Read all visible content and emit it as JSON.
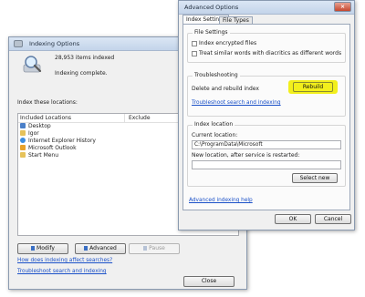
{
  "indexing_window": {
    "title": "Indexing Options",
    "items_indexed": "28,953 items indexed",
    "status": "Indexing complete.",
    "index_these_label": "Index these locations:",
    "columns": [
      "Included Locations",
      "Exclude"
    ],
    "locations": [
      "Desktop",
      "Igor",
      "Internet Explorer History",
      "Microsoft Outlook",
      "Start Menu"
    ],
    "buttons": {
      "modify": "Modify",
      "advanced": "Advanced",
      "pause": "Pause",
      "close": "Close"
    },
    "links": {
      "how_affect": "How does indexing affect searches?",
      "troubleshoot": "Troubleshoot search and indexing"
    }
  },
  "advanced_window": {
    "title": "Advanced Options",
    "tabs": [
      "Index Settings",
      "File Types"
    ],
    "file_settings": {
      "heading": "File Settings",
      "option1": "Index encrypted files",
      "option2": "Treat similar words with diacritics as different words"
    },
    "troubleshooting": {
      "heading": "Troubleshooting",
      "delete_rebuild": "Delete and rebuild index",
      "rebuild": "Rebuild",
      "link": "Troubleshoot search and indexing"
    },
    "index_location": {
      "heading": "Index location",
      "current_label": "Current location:",
      "current_value": "C:\\ProgramData\\Microsoft",
      "new_label": "New location, after service is restarted:",
      "new_value": "",
      "select_new": "Select new"
    },
    "help_link": "Advanced indexing help",
    "ok": "OK",
    "cancel": "Cancel"
  },
  "colors": {
    "highlight": "#f2ef1c",
    "link": "#1a50c8"
  }
}
